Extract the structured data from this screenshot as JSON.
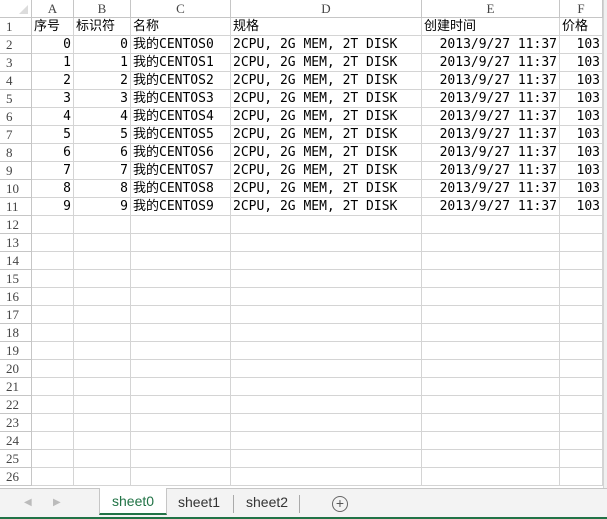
{
  "columns": [
    "A",
    "B",
    "C",
    "D",
    "E",
    "F"
  ],
  "header_row": [
    "序号",
    "标识符",
    "名称",
    "规格",
    "创建时间",
    "价格"
  ],
  "data_rows": [
    [
      "0",
      "0",
      "我的CENTOS0",
      "2CPU, 2G MEM, 2T DISK",
      "2013/9/27 11:37",
      "103"
    ],
    [
      "1",
      "1",
      "我的CENTOS1",
      "2CPU, 2G MEM, 2T DISK",
      "2013/9/27 11:37",
      "103"
    ],
    [
      "2",
      "2",
      "我的CENTOS2",
      "2CPU, 2G MEM, 2T DISK",
      "2013/9/27 11:37",
      "103"
    ],
    [
      "3",
      "3",
      "我的CENTOS3",
      "2CPU, 2G MEM, 2T DISK",
      "2013/9/27 11:37",
      "103"
    ],
    [
      "4",
      "4",
      "我的CENTOS4",
      "2CPU, 2G MEM, 2T DISK",
      "2013/9/27 11:37",
      "103"
    ],
    [
      "5",
      "5",
      "我的CENTOS5",
      "2CPU, 2G MEM, 2T DISK",
      "2013/9/27 11:37",
      "103"
    ],
    [
      "6",
      "6",
      "我的CENTOS6",
      "2CPU, 2G MEM, 2T DISK",
      "2013/9/27 11:37",
      "103"
    ],
    [
      "7",
      "7",
      "我的CENTOS7",
      "2CPU, 2G MEM, 2T DISK",
      "2013/9/27 11:37",
      "103"
    ],
    [
      "8",
      "8",
      "我的CENTOS8",
      "2CPU, 2G MEM, 2T DISK",
      "2013/9/27 11:37",
      "103"
    ],
    [
      "9",
      "9",
      "我的CENTOS9",
      "2CPU, 2G MEM, 2T DISK",
      "2013/9/27 11:37",
      "103"
    ]
  ],
  "row_count": 26,
  "tabs": [
    "sheet0",
    "sheet1",
    "sheet2"
  ],
  "add_sheet_icon": "plus-circle-icon",
  "colors": {
    "accent": "#217346",
    "grid": "#d4d4d4"
  }
}
